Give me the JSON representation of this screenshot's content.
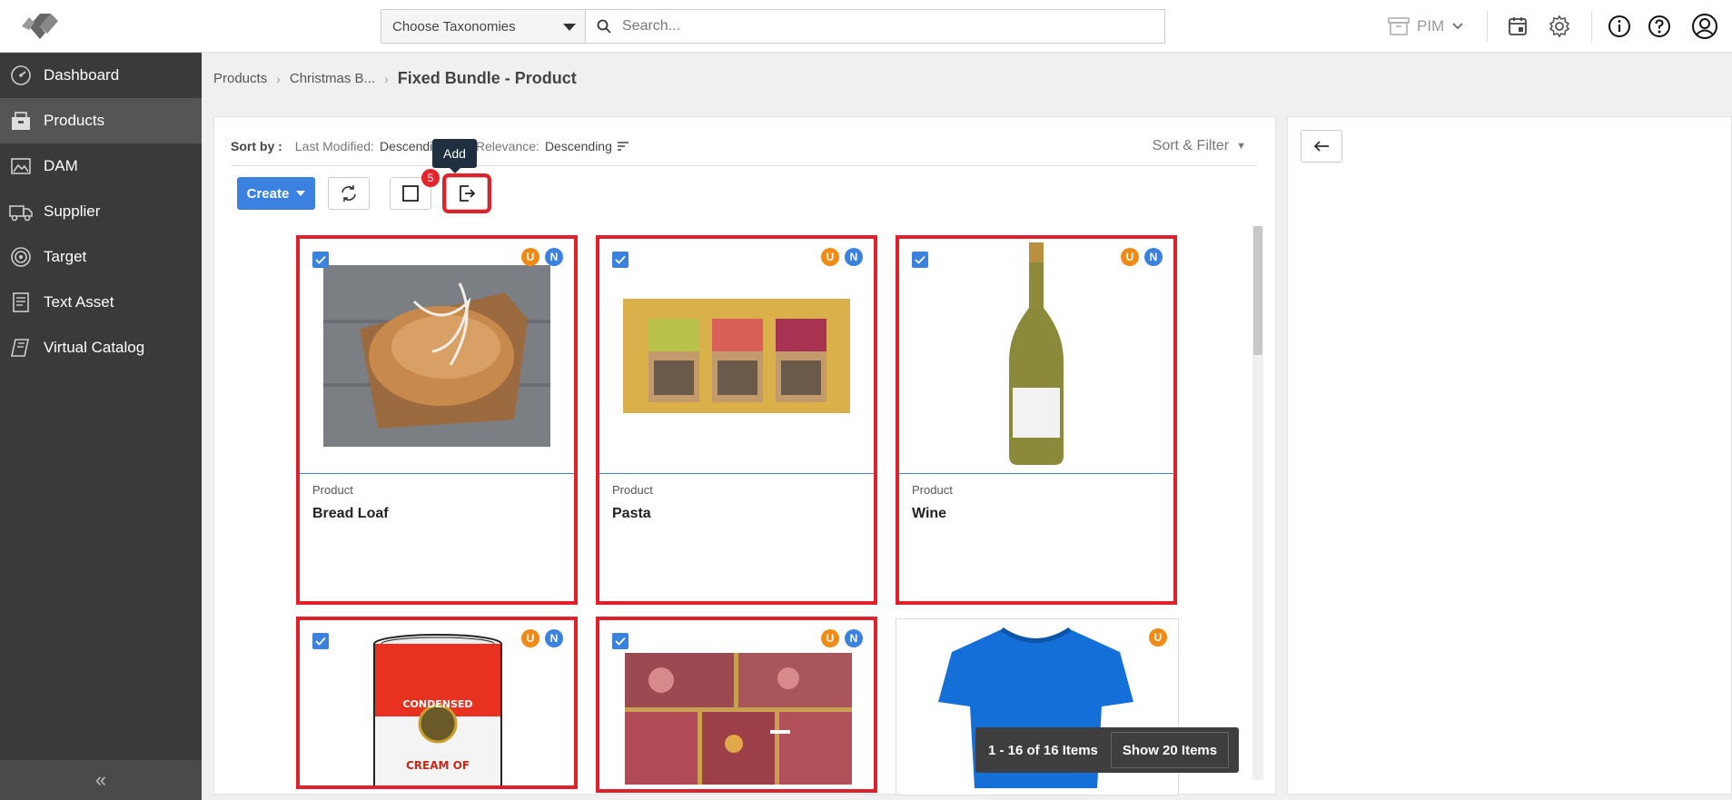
{
  "topbar": {
    "taxonomy_select": "Choose Taxonomies",
    "search_placeholder": "Search...",
    "pim_label": "PIM"
  },
  "sidebar": {
    "items": [
      {
        "label": "Dashboard",
        "icon": "dashboard-icon"
      },
      {
        "label": "Products",
        "icon": "products-icon",
        "active": true
      },
      {
        "label": "DAM",
        "icon": "image-icon"
      },
      {
        "label": "Supplier",
        "icon": "truck-icon"
      },
      {
        "label": "Target",
        "icon": "target-icon"
      },
      {
        "label": "Text Asset",
        "icon": "document-icon"
      },
      {
        "label": "Virtual Catalog",
        "icon": "catalog-icon"
      }
    ],
    "collapse": "«"
  },
  "breadcrumb": {
    "items": [
      "Products",
      "Christmas B...",
      "Fixed Bundle - Product"
    ]
  },
  "sortbar": {
    "label": "Sort by :",
    "last_modified_key": "Last Modified:",
    "last_modified_val": "Descending",
    "relevance_key": "Relevance:",
    "relevance_val": "Descending",
    "sort_filter": "Sort & Filter"
  },
  "toolbar": {
    "create_label": "Create",
    "selected_count": "5",
    "tooltip": "Add"
  },
  "cards": [
    {
      "type": "Product",
      "name": "Bread Loaf",
      "flags": [
        "U",
        "N"
      ],
      "selected": true,
      "image": "bread-loaf"
    },
    {
      "type": "Product",
      "name": "Pasta",
      "flags": [
        "U",
        "N"
      ],
      "selected": true,
      "image": "pasta"
    },
    {
      "type": "Product",
      "name": "Wine",
      "flags": [
        "U",
        "N"
      ],
      "selected": true,
      "image": "wine"
    },
    {
      "type": "",
      "name": "",
      "flags": [
        "U",
        "N"
      ],
      "selected": true,
      "image": "soup-can",
      "can_text_1": "CONDENSED",
      "can_text_2": "CREAM OF"
    },
    {
      "type": "",
      "name": "",
      "flags": [
        "U",
        "N"
      ],
      "selected": true,
      "image": "meat"
    },
    {
      "type": "",
      "name": "",
      "flags": [
        "U"
      ],
      "selected": false,
      "image": "t-shirt"
    }
  ],
  "pager": {
    "range": "1 - 16 of 16 Items",
    "show": "Show 20 Items"
  }
}
